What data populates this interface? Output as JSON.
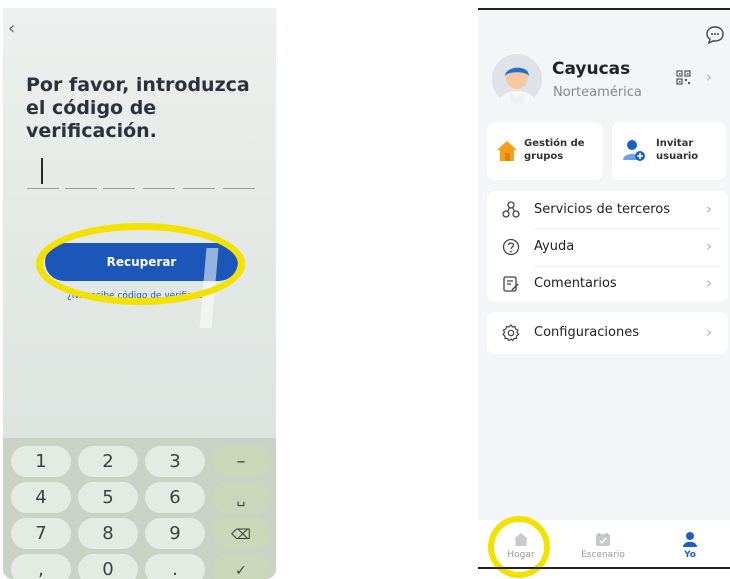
{
  "left": {
    "back_glyph": "‹",
    "title": "Por favor, introduzca el código de verificación.",
    "recover_label": "Recuperar",
    "no_code_text": "¿No recibe código de verificac",
    "keys": [
      "1",
      "2",
      "3",
      "–",
      "4",
      "5",
      "6",
      "␣",
      "7",
      "8",
      "9",
      "⌫",
      ",",
      "0",
      ".",
      "✓"
    ]
  },
  "right": {
    "user_name": "Cayucas",
    "region": "Norteamérica",
    "quick_actions": [
      {
        "label_line1": "Gestión de",
        "label_line2": "grupos",
        "icon": "house-icon"
      },
      {
        "label_line1": "Invitar",
        "label_line2": "usuario",
        "icon": "add-user-icon"
      }
    ],
    "menu": [
      {
        "label": "Servicios de terceros",
        "icon": "third-party-icon"
      },
      {
        "label": "Ayuda",
        "icon": "help-icon"
      },
      {
        "label": "Comentarios",
        "icon": "feedback-icon"
      }
    ],
    "settings_label": "Configuraciones",
    "tabs": [
      {
        "label": "Hogar",
        "icon": "home-icon",
        "active": false
      },
      {
        "label": "Escenario",
        "icon": "scene-icon",
        "active": false
      },
      {
        "label": "Yo",
        "icon": "profile-icon",
        "active": true
      }
    ],
    "colors": {
      "accent": "#1d5fc1",
      "orange": "#f5a019",
      "highlight": "#f3e100"
    }
  }
}
